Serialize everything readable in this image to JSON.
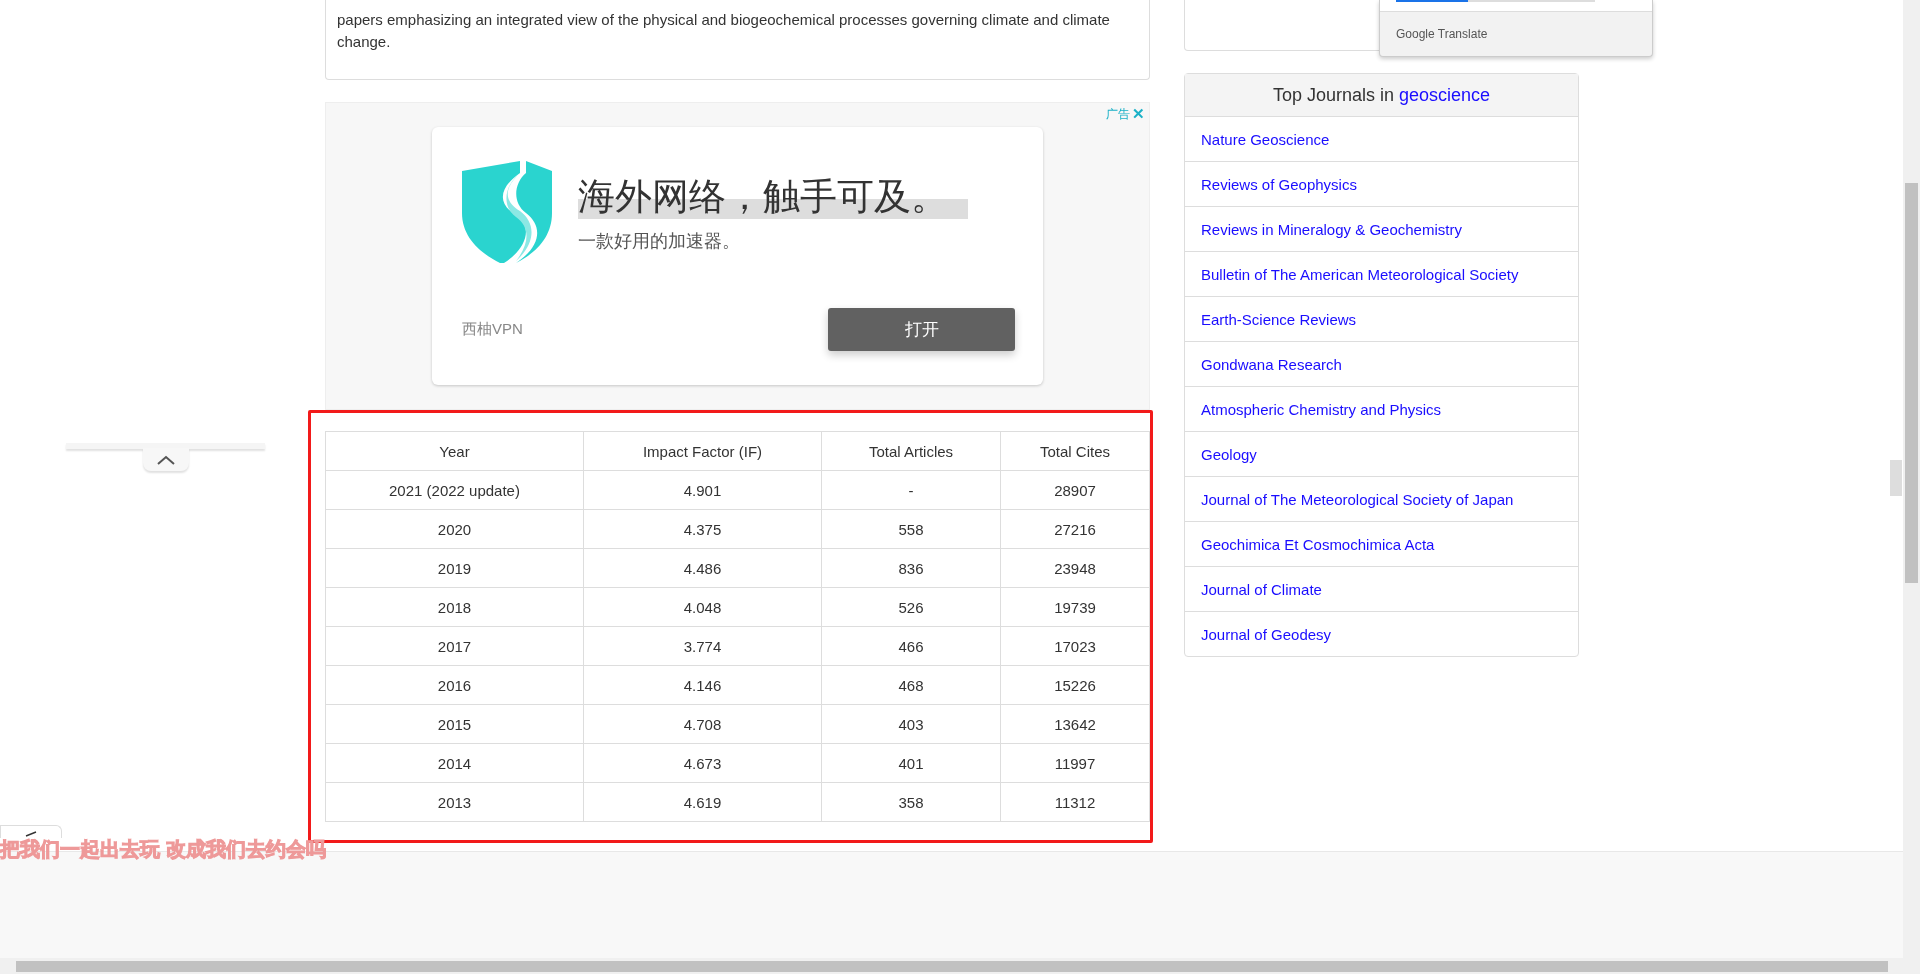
{
  "description": {
    "lines": [
      "papers emphasizing an integrated view of the physical and biogeochemical processes governing climate and climate",
      "change."
    ]
  },
  "ad": {
    "badge": "广告",
    "close": "✕",
    "headline": "海外网络，触手可及。",
    "subline": "一款好用的加速器。",
    "brand": "西柚VPN",
    "button": "打开"
  },
  "table": {
    "columns": [
      "Year",
      "Impact Factor (IF)",
      "Total Articles",
      "Total Cites"
    ],
    "rows": [
      [
        "2021 (2022 update)",
        "4.901",
        "-",
        "28907"
      ],
      [
        "2020",
        "4.375",
        "558",
        "27216"
      ],
      [
        "2019",
        "4.486",
        "836",
        "23948"
      ],
      [
        "2018",
        "4.048",
        "526",
        "19739"
      ],
      [
        "2017",
        "3.774",
        "466",
        "17023"
      ],
      [
        "2016",
        "4.146",
        "468",
        "15226"
      ],
      [
        "2015",
        "4.708",
        "403",
        "13642"
      ],
      [
        "2014",
        "4.673",
        "401",
        "11997"
      ],
      [
        "2013",
        "4.619",
        "358",
        "11312"
      ]
    ]
  },
  "translate_popup": {
    "label": "Google Translate",
    "progress": {
      "level": 0.36
    }
  },
  "top_journals": {
    "title": "Top Journals in",
    "topic": "geoscience",
    "items": [
      "Nature Geoscience",
      "Reviews of Geophysics",
      "Reviews in Mineralogy & Geochemistry",
      "Bulletin of The American Meteorological Society",
      "Earth-Science Reviews",
      "Gondwana Research",
      "Atmospheric Chemistry and Physics",
      "Geology",
      "Journal of The Meteorological Society of Japan",
      "Geochimica Et Cosmochimica Acta",
      "Journal of Climate",
      "Journal of Geodesy"
    ]
  },
  "overlay_text": "把我们一起出去玩 改成我们去约会吗"
}
